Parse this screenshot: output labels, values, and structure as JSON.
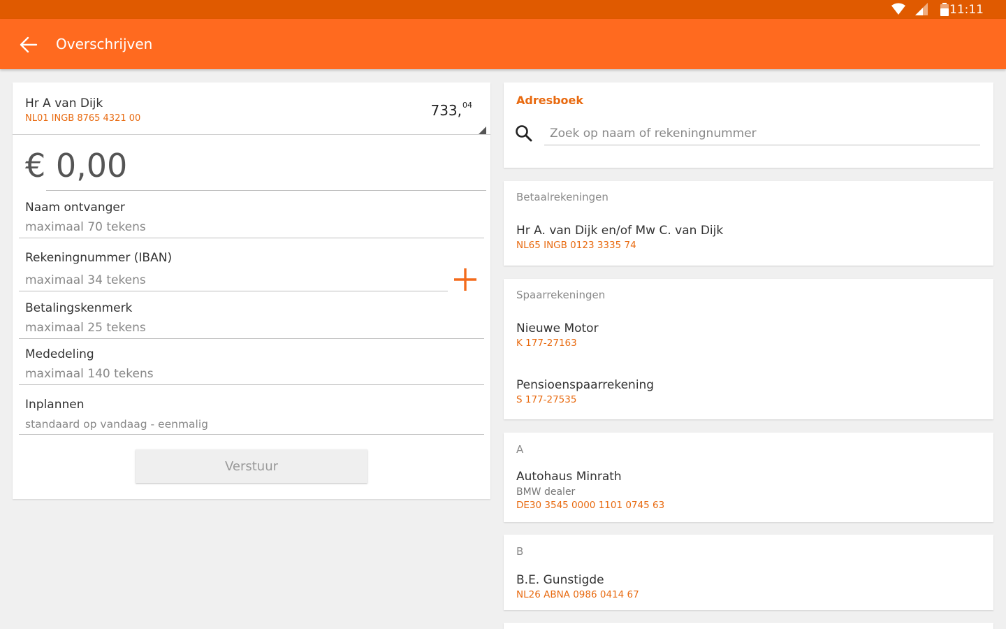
{
  "status_bar": {
    "time": "11:11"
  },
  "app_bar": {
    "title": "Overschrijven"
  },
  "from_account": {
    "name": "Hr A van Dijk",
    "iban": "NL01 INGB 8765 4321 00",
    "balance_main": "733,",
    "balance_cents": "04"
  },
  "amount": "€ 0,00",
  "fields": [
    {
      "label": "Naam ontvanger",
      "placeholder": "maximaal 70 tekens"
    },
    {
      "label": "Rekeningnummer (IBAN)",
      "placeholder": "maximaal 34 tekens"
    },
    {
      "label": "Betalingskenmerk",
      "placeholder": "maximaal 25 tekens"
    },
    {
      "label": "Mededeling",
      "placeholder": "maximaal 140 tekens"
    },
    {
      "label": "Inplannen",
      "placeholder": "standaard op vandaag - eenmalig"
    }
  ],
  "send_label": "Verstuur",
  "addressbook": {
    "title": "Adresboek",
    "search_placeholder": "Zoek op naam of rekeningnummer"
  },
  "sections": [
    {
      "title": "Betaalrekeningen",
      "items": [
        {
          "name": "Hr A. van Dijk en/of Mw C. van Dijk",
          "iban": "NL65 INGB 0123 3335 74"
        }
      ]
    },
    {
      "title": "Spaarrekeningen",
      "items": [
        {
          "name": "Nieuwe Motor",
          "iban": "K 177-27163"
        },
        {
          "name": "Pensioenspaarrekening",
          "iban": "S 177-27535"
        }
      ]
    },
    {
      "title": "A",
      "items": [
        {
          "name": "Autohaus Minrath",
          "sub": "BMW dealer",
          "iban": "DE30 3545 0000 1101 0745 63"
        }
      ]
    },
    {
      "title": "B",
      "items": [
        {
          "name": "B.E. Gunstigde",
          "iban": "NL26 ABNA 0986 0414 67"
        }
      ]
    }
  ],
  "colors": {
    "status_bar": "#e05a00",
    "app_bar": "#ff6a1f",
    "accent": "#e86a10"
  }
}
